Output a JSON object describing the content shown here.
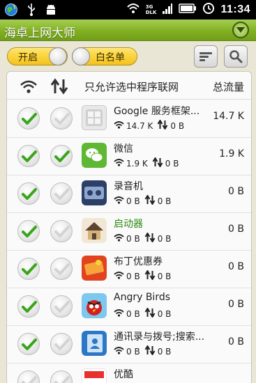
{
  "status_bar": {
    "time": "11:34",
    "net_tag_top": "3G",
    "net_tag_bottom": "DLK",
    "icons": [
      "globe-icon",
      "usb-icon",
      "android-icon",
      "wifi-icon",
      "signal-icon",
      "battery-icon",
      "alarm-icon"
    ]
  },
  "titlebar": {
    "title": "海卓上网大师"
  },
  "toolbar": {
    "toggle_on_label": "开启",
    "whitelist_label": "白名单"
  },
  "header": {
    "filter_label": "只允许选中程序联网",
    "total_label": "总流量"
  },
  "apps": [
    {
      "name": "Google 服务框架...",
      "wifi": "14.7 K",
      "mobile": "0 B",
      "total": "14.7 K",
      "wifi_allowed": true,
      "mobile_allowed": false,
      "icon": "google-services-icon",
      "highlight": false
    },
    {
      "name": "微信",
      "wifi": "1.9 K",
      "mobile": "0 B",
      "total": "1.9 K",
      "wifi_allowed": true,
      "mobile_allowed": true,
      "icon": "wechat-icon",
      "highlight": false
    },
    {
      "name": "录音机",
      "wifi": "0 B",
      "mobile": "0 B",
      "total": "0 B",
      "wifi_allowed": true,
      "mobile_allowed": false,
      "icon": "recorder-icon",
      "highlight": false
    },
    {
      "name": "启动器",
      "wifi": "0 B",
      "mobile": "0 B",
      "total": "0 B",
      "wifi_allowed": true,
      "mobile_allowed": false,
      "icon": "launcher-icon",
      "highlight": true
    },
    {
      "name": "布丁优惠券",
      "wifi": "0 B",
      "mobile": "0 B",
      "total": "0 B",
      "wifi_allowed": true,
      "mobile_allowed": false,
      "icon": "coupon-icon",
      "highlight": false
    },
    {
      "name": "Angry Birds",
      "wifi": "0 B",
      "mobile": "0 B",
      "total": "0 B",
      "wifi_allowed": true,
      "mobile_allowed": false,
      "icon": "angry-birds-icon",
      "highlight": false
    },
    {
      "name": "通讯录与拨号;搜索...",
      "wifi": "0 B",
      "mobile": "0 B",
      "total": "0 B",
      "wifi_allowed": true,
      "mobile_allowed": false,
      "icon": "contacts-icon",
      "highlight": false
    },
    {
      "name": "优酷",
      "wifi": "",
      "mobile": "",
      "total": "",
      "wifi_allowed": false,
      "mobile_allowed": false,
      "icon": "youku-icon",
      "highlight": false
    }
  ],
  "colors": {
    "accent_green": "#82b023",
    "check_green": "#3aa51a",
    "pill_yellow": "#f4c21b"
  }
}
